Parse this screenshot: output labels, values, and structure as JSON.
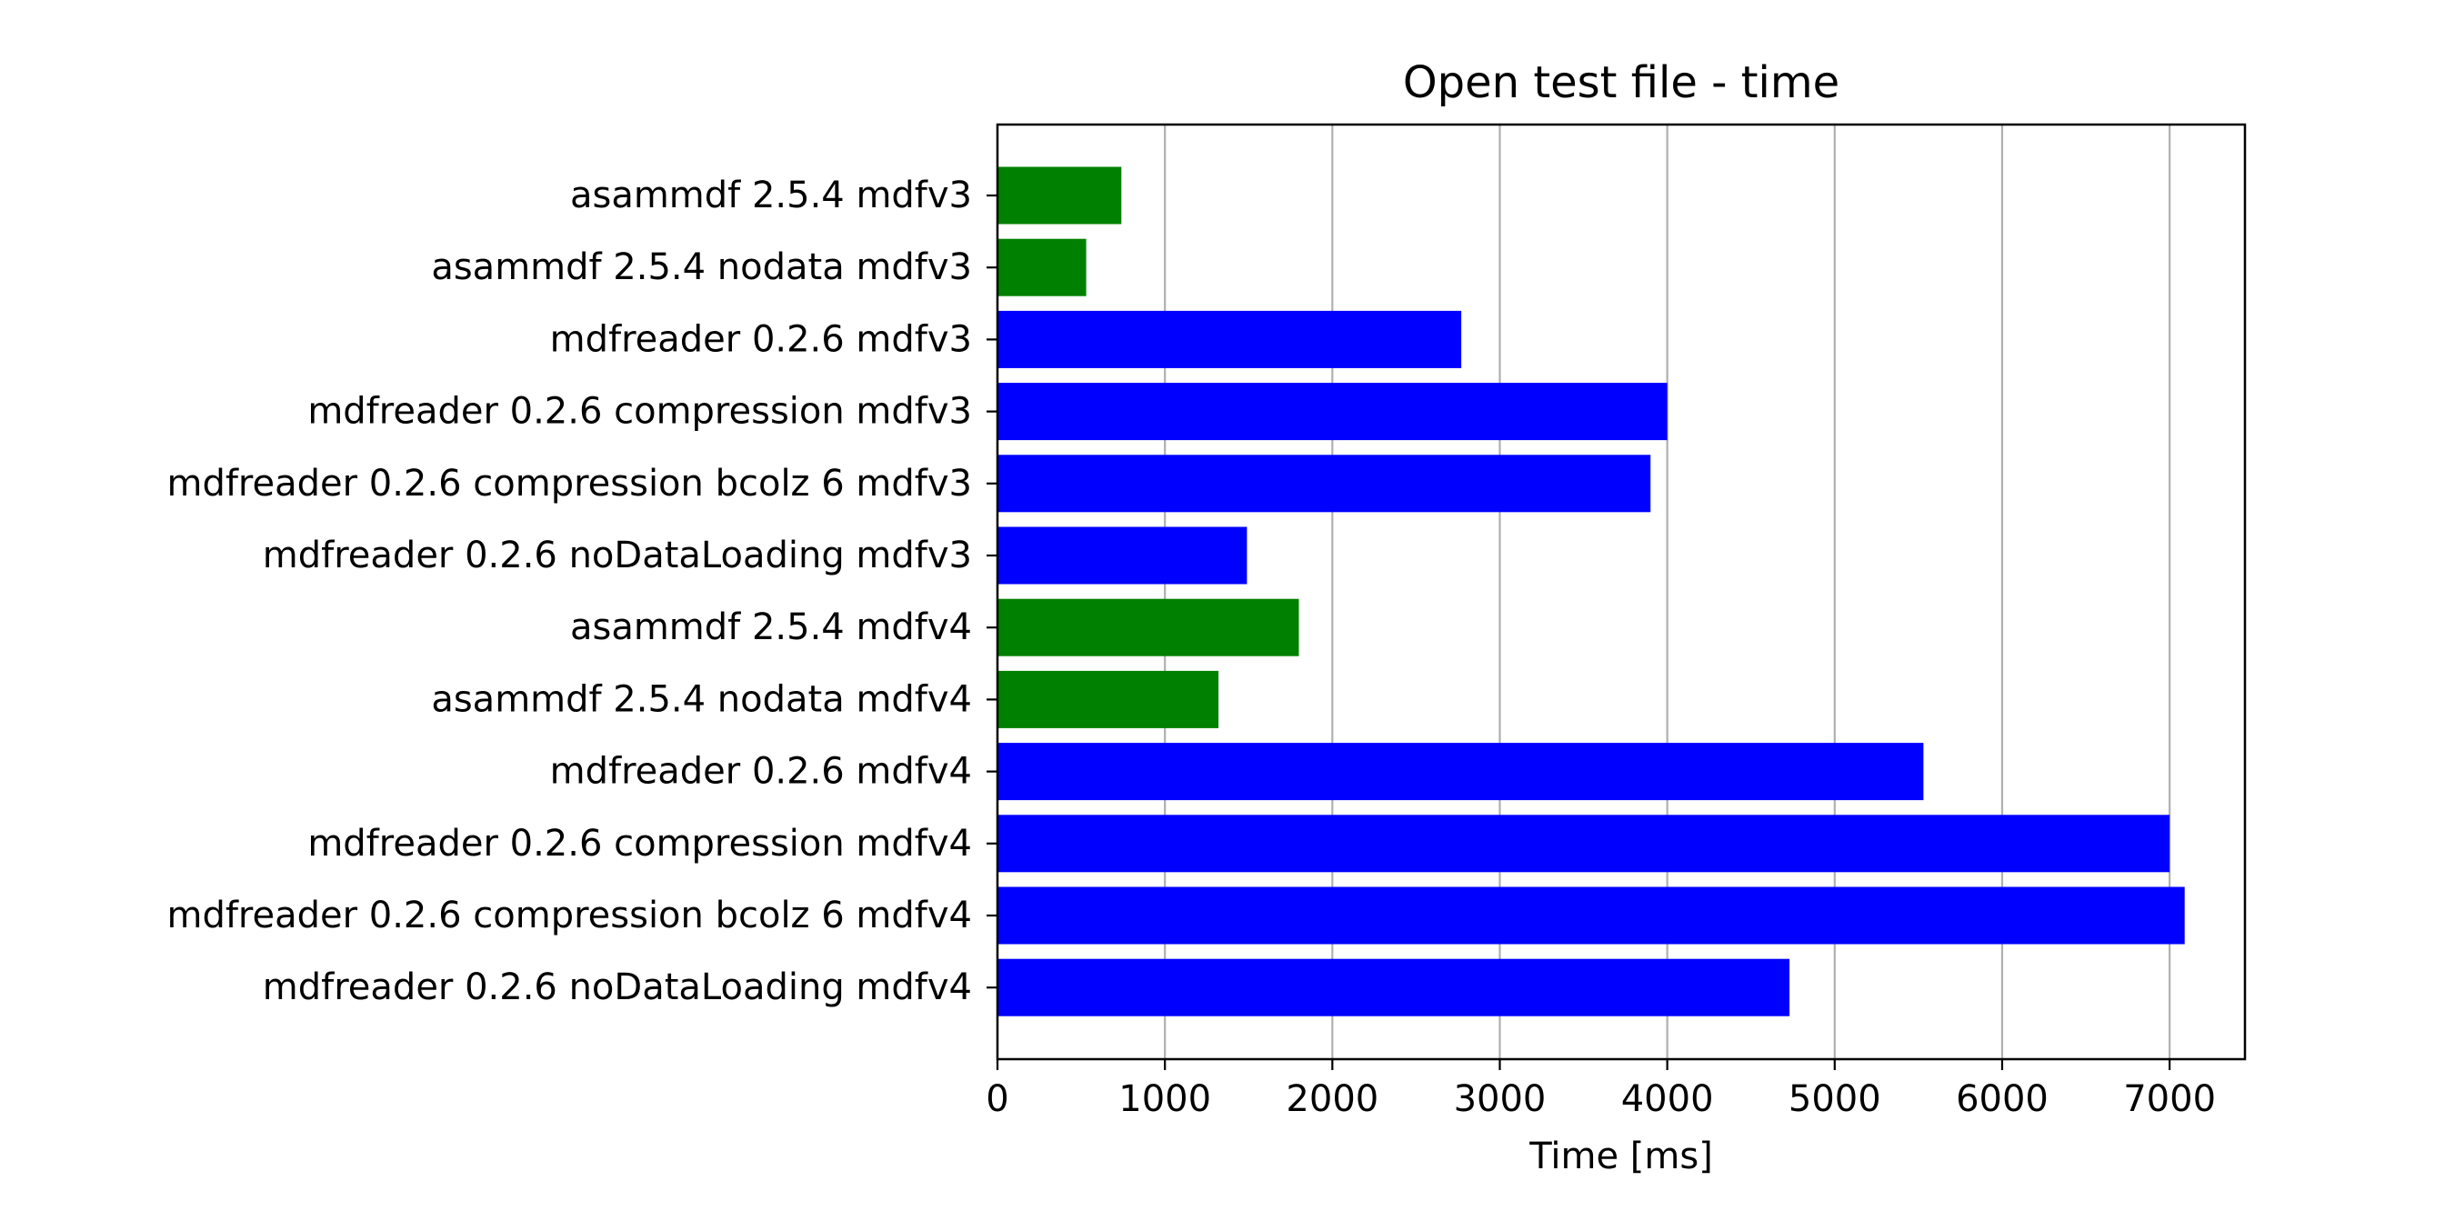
{
  "chart_data": {
    "type": "bar",
    "orientation": "horizontal",
    "title": "Open test file - time",
    "xlabel": "Time [ms]",
    "ylabel": "",
    "xlim": [
      0,
      7450
    ],
    "xticks": [
      0,
      1000,
      2000,
      3000,
      4000,
      5000,
      6000,
      7000
    ],
    "grid": "x",
    "categories": [
      "asammdf 2.5.4 mdfv3",
      "asammdf 2.5.4 nodata mdfv3",
      "mdfreader 0.2.6 mdfv3",
      "mdfreader 0.2.6 compression mdfv3",
      "mdfreader 0.2.6 compression bcolz 6 mdfv3",
      "mdfreader 0.2.6 noDataLoading mdfv3",
      "asammdf 2.5.4 mdfv4",
      "asammdf 2.5.4 nodata mdfv4",
      "mdfreader 0.2.6 mdfv4",
      "mdfreader 0.2.6 compression mdfv4",
      "mdfreader 0.2.6 compression bcolz 6 mdfv4",
      "mdfreader 0.2.6 noDataLoading mdfv4"
    ],
    "values": [
      740,
      530,
      2770,
      4000,
      3900,
      1490,
      1800,
      1320,
      5530,
      7000,
      7090,
      4730
    ],
    "bar_colors": [
      "#008000",
      "#008000",
      "#0000ff",
      "#0000ff",
      "#0000ff",
      "#0000ff",
      "#008000",
      "#008000",
      "#0000ff",
      "#0000ff",
      "#0000ff",
      "#0000ff"
    ],
    "grid_color": "#b0b0b0",
    "axis_color": "#000000"
  }
}
